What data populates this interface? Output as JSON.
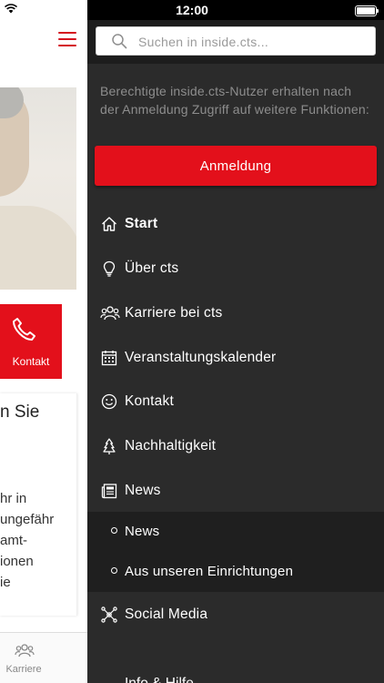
{
  "status_bar": {
    "time": "12:00"
  },
  "search": {
    "placeholder": "Suchen in inside.cts..."
  },
  "info_text": "Berechtigte inside.cts-Nutzer erhalten nach der Anmeldung Zugriff auf weitere Funktionen:",
  "login_label": "Anmeldung",
  "nav": {
    "items": [
      {
        "label": "Start",
        "icon": "home-icon"
      },
      {
        "label": "Über cts",
        "icon": "lightbulb-icon"
      },
      {
        "label": "Karriere bei cts",
        "icon": "people-icon"
      },
      {
        "label": "Veranstaltungskalender",
        "icon": "calendar-icon"
      },
      {
        "label": "Kontakt",
        "icon": "smiley-icon"
      },
      {
        "label": "Nachhaltigkeit",
        "icon": "tree-icon"
      },
      {
        "label": "News",
        "icon": "newspaper-icon"
      },
      {
        "label": "Social Media",
        "icon": "network-icon"
      }
    ],
    "sub_items": [
      {
        "label": "News"
      },
      {
        "label": "Aus unseren Einrichtungen"
      }
    ],
    "partial_label": "Info & Hilfe"
  },
  "background": {
    "contact_label": "Kontakt",
    "card_heading": "n Sie",
    "card_body": "hr in\nungefähr\namt-\nionen\nie",
    "tab_label": "Karriere"
  },
  "colors": {
    "accent": "#e3101b",
    "drawer": "#2b2b2b",
    "submenu": "#1f1f1f"
  }
}
